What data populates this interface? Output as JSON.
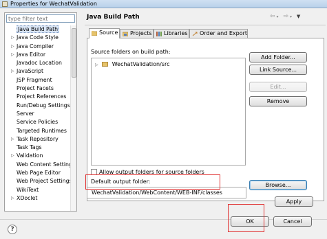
{
  "window": {
    "title": "Properties for WechatValidation"
  },
  "filter": {
    "placeholder": "type filter text"
  },
  "tree": [
    {
      "label": "Java Build Path",
      "expandable": false,
      "selected": true
    },
    {
      "label": "Java Code Style",
      "expandable": true
    },
    {
      "label": "Java Compiler",
      "expandable": true
    },
    {
      "label": "Java Editor",
      "expandable": true
    },
    {
      "label": "Javadoc Location",
      "expandable": false
    },
    {
      "label": "JavaScript",
      "expandable": true
    },
    {
      "label": "JSP Fragment",
      "expandable": false
    },
    {
      "label": "Project Facets",
      "expandable": false
    },
    {
      "label": "Project References",
      "expandable": false
    },
    {
      "label": "Run/Debug Settings",
      "expandable": false
    },
    {
      "label": "Server",
      "expandable": false
    },
    {
      "label": "Service Policies",
      "expandable": false
    },
    {
      "label": "Targeted Runtimes",
      "expandable": false
    },
    {
      "label": "Task Repository",
      "expandable": true
    },
    {
      "label": "Task Tags",
      "expandable": false
    },
    {
      "label": "Validation",
      "expandable": true
    },
    {
      "label": "Web Content Settings",
      "expandable": false
    },
    {
      "label": "Web Page Editor",
      "expandable": false
    },
    {
      "label": "Web Project Settings",
      "expandable": false
    },
    {
      "label": "WikiText",
      "expandable": false
    },
    {
      "label": "XDoclet",
      "expandable": true
    }
  ],
  "page": {
    "title": "Java Build Path"
  },
  "tabs": [
    {
      "label": "Source",
      "active": true
    },
    {
      "label": "Projects"
    },
    {
      "label": "Libraries"
    },
    {
      "label": "Order and Export"
    }
  ],
  "source": {
    "folders_label": "Source folders on build path:",
    "folders": [
      {
        "label": "WechatValidation/src"
      }
    ]
  },
  "buttons": {
    "add_folder": "Add Folder...",
    "link_source": "Link Source...",
    "edit": "Edit...",
    "remove": "Remove",
    "browse": "Browse...",
    "apply": "Apply",
    "ok": "OK",
    "cancel": "Cancel"
  },
  "allow_output": {
    "label": "Allow output folders for source folders",
    "checked": false
  },
  "output": {
    "label": "Default output folder:",
    "value": "WechatValidation/WebContent/WEB-INF/classes"
  },
  "help": {
    "symbol": "?"
  },
  "nav_icons": [
    "back-icon",
    "forward-icon",
    "menu-icon"
  ],
  "colors": {
    "highlight_box": "#e03030",
    "selection": "#d9e5f5"
  }
}
